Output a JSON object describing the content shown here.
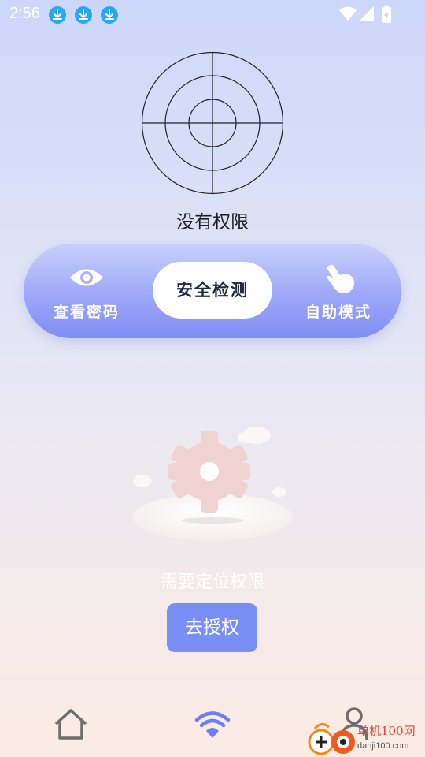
{
  "status_bar": {
    "time": "2:56",
    "icons": [
      "download-icon",
      "download-icon",
      "download-icon",
      "wifi-icon",
      "signal-icon",
      "battery-charging-icon"
    ]
  },
  "radar": {
    "title": "没有权限"
  },
  "mode_bar": {
    "items": [
      {
        "label": "查看密码",
        "icon": "eye-icon"
      },
      {
        "label": "安全检测",
        "active": true
      },
      {
        "label": "自助模式",
        "icon": "hand-tap-icon"
      }
    ]
  },
  "permission": {
    "message": "需要定位权限",
    "button_label": "去授权"
  },
  "bottom_nav": {
    "items": [
      {
        "icon": "home-icon"
      },
      {
        "icon": "wifi-icon",
        "active": true
      },
      {
        "icon": "user-icon"
      }
    ]
  },
  "watermark": {
    "text": "单机100网",
    "url": "danji100.com"
  },
  "colors": {
    "accent": "#7a8ff6",
    "active_nav": "#6e7ff5",
    "download_badge": "#2aa7f3"
  }
}
